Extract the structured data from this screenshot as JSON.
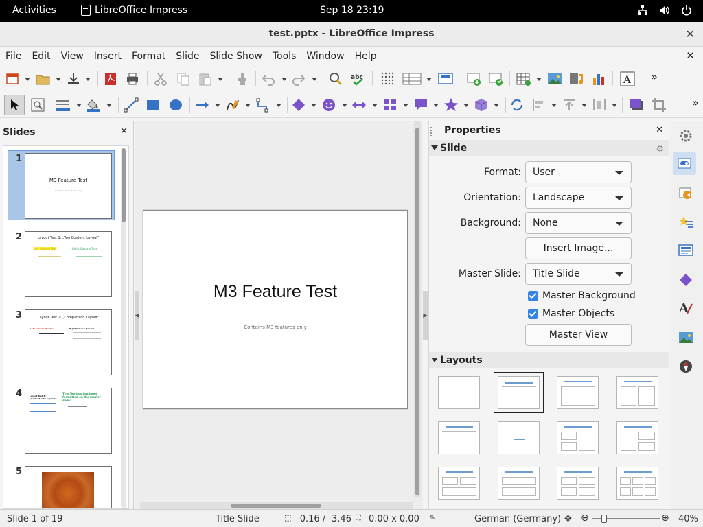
{
  "topbar": {
    "activities": "Activities",
    "app_name": "LibreOffice Impress",
    "clock": "Sep 18  23:19"
  },
  "window": {
    "title": "test.pptx - LibreOffice Impress"
  },
  "menu": {
    "items": [
      "File",
      "Edit",
      "View",
      "Insert",
      "Format",
      "Slide",
      "Slide Show",
      "Tools",
      "Window",
      "Help"
    ]
  },
  "slides_panel": {
    "title": "Slides",
    "thumbnails": [
      {
        "num": "1",
        "title": "M3 Feature Test",
        "sub": "Contains M3 features only"
      },
      {
        "num": "2",
        "title": "Layout Test 1: „Two Content Layout\"",
        "left": "Left Column Text",
        "right": "Right Column Text"
      },
      {
        "num": "3",
        "title": "Layout Test 2: „Comparison Layout\"",
        "left": "Left Column Header",
        "right": "Right Column Header"
      },
      {
        "num": "4",
        "title": "Layout Test 3: „Content with Caption\"",
        "right": "This Textbox has been formatted on the master slide:"
      },
      {
        "num": "5"
      }
    ]
  },
  "slide": {
    "title": "M3 Feature Test",
    "subtitle": "Contains M3 features only"
  },
  "properties": {
    "title": "Properties",
    "slide_section": "Slide",
    "format_label": "Format:",
    "format_value": "User",
    "orientation_label": "Orientation:",
    "orientation_value": "Landscape",
    "background_label": "Background:",
    "background_value": "None",
    "insert_image": "Insert Image...",
    "master_slide_label": "Master Slide:",
    "master_slide_value": "Title Slide",
    "master_background": "Master Background",
    "master_objects": "Master Objects",
    "master_view": "Master View",
    "layouts_section": "Layouts"
  },
  "status": {
    "slide_of": "Slide 1 of 19",
    "master": "Title Slide",
    "position": "-0.16 / -3.46",
    "size": "0.00 x 0.00",
    "language": "German (Germany)",
    "zoom": "40%"
  },
  "colors": {
    "accent": "#3584e4",
    "layout_bar": "#6b9bd1",
    "selection": "#a9c6e8"
  }
}
